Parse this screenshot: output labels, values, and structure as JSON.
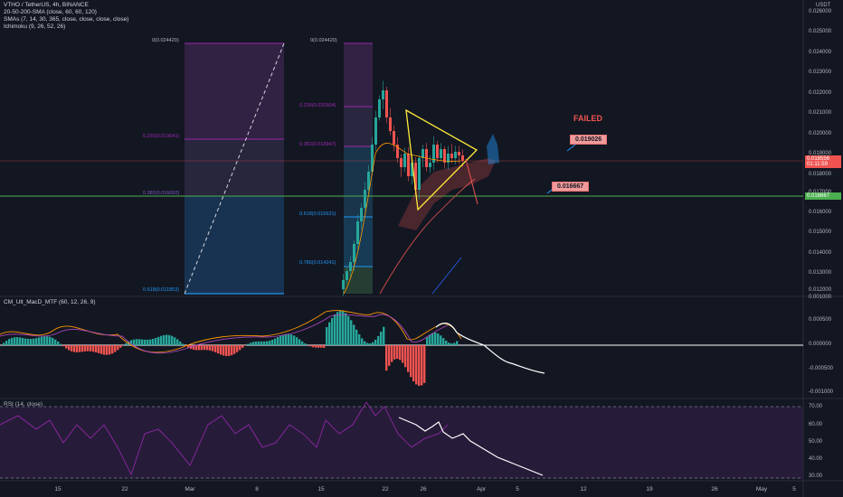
{
  "header": {
    "symbol_line": "VTHO / TetherUS, 4h, BINANCE",
    "indicator_1": "20-50-200-SMA (close, 60, 60, 120)",
    "indicator_2": "SMAs (7, 14, 30, 365, close, close, close, close)",
    "indicator_3": "Ichimoku (9, 26, 52, 26)"
  },
  "price_axis": {
    "currency": "USDT",
    "labels": [
      "0.026000",
      "0.025000",
      "0.024000",
      "0.023000",
      "0.022000",
      "0.021000",
      "0.020000",
      "0.019000",
      "0.018000",
      "0.017000",
      "0.016000",
      "0.015000",
      "0.014000",
      "0.013000",
      "0.012000"
    ],
    "current_price": "0.018556",
    "countdown": "01:11:59",
    "line_price": "0.016667"
  },
  "fib_left": {
    "top": "0(0.024420)",
    "mid": "0.236(0.019641)",
    "lower": "0.382(0.016692)",
    "bottom": "0.618(0.011853)"
  },
  "fib_right": {
    "top": "0(0.024420)",
    "l1": "0.236(0.020504)",
    "l2": "0.382(0.018947)",
    "l3": "0.618(0.015631)",
    "l4": "0.786(0.014241)"
  },
  "annotations": {
    "failed": "FAILED",
    "target_high": "0.019026",
    "target_low": "0.016667"
  },
  "macd": {
    "title": "CM_Ult_MacD_MTF (60, 12, 26, 9)",
    "labels": [
      "0.001000",
      "0.000500",
      "0.000000",
      "-0.000500",
      "-0.001000"
    ]
  },
  "rsi": {
    "title": "RSI (14, close)",
    "labels": [
      "70.00",
      "60.00",
      "50.00",
      "40.00",
      "30.00"
    ]
  },
  "time_axis": [
    "15",
    "22",
    "Mar",
    "8",
    "15",
    "22",
    "26",
    "Apr",
    "5",
    "12",
    "19",
    "26",
    "May",
    "5"
  ],
  "colors": {
    "bg": "#131722",
    "up": "#26a69a",
    "down": "#ef5350",
    "triangle": "#ffeb3b",
    "fib_purple": "#9c27b0",
    "fib_blue": "#2196f3",
    "green_line": "#4caf50",
    "failed_text": "#ef5350"
  }
}
